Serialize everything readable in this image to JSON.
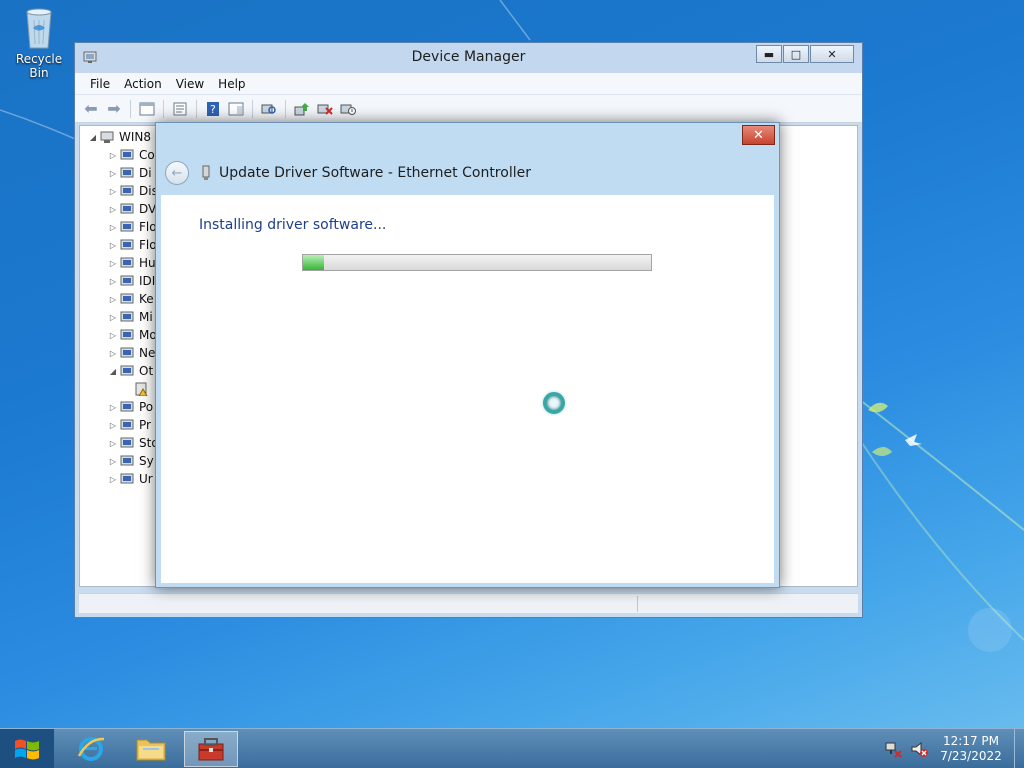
{
  "desktop": {
    "recycle_bin_label": "Recycle Bin"
  },
  "device_manager": {
    "title": "Device Manager",
    "menu": [
      "File",
      "Action",
      "View",
      "Help"
    ],
    "tree": {
      "root": "WIN8",
      "items": [
        "Co",
        "Di",
        "Dis",
        "DV",
        "Flo",
        "Flo",
        "Hu",
        "IDI",
        "Ke",
        "Mi",
        "Mo",
        "Ne",
        "Ot",
        "",
        "Po",
        "Pr",
        "Sto",
        "Sy",
        "Ur"
      ]
    }
  },
  "dialog": {
    "title": "Update Driver Software - Ethernet Controller",
    "status_text": "Installing driver software...",
    "progress_fraction": 0.06
  },
  "taskbar": {
    "clock_time": "12:17 PM",
    "clock_date": "7/23/2022"
  },
  "colors": {
    "accent": "#1e3f8a",
    "close_red": "#c7452f",
    "progress_green": "#36b536"
  }
}
